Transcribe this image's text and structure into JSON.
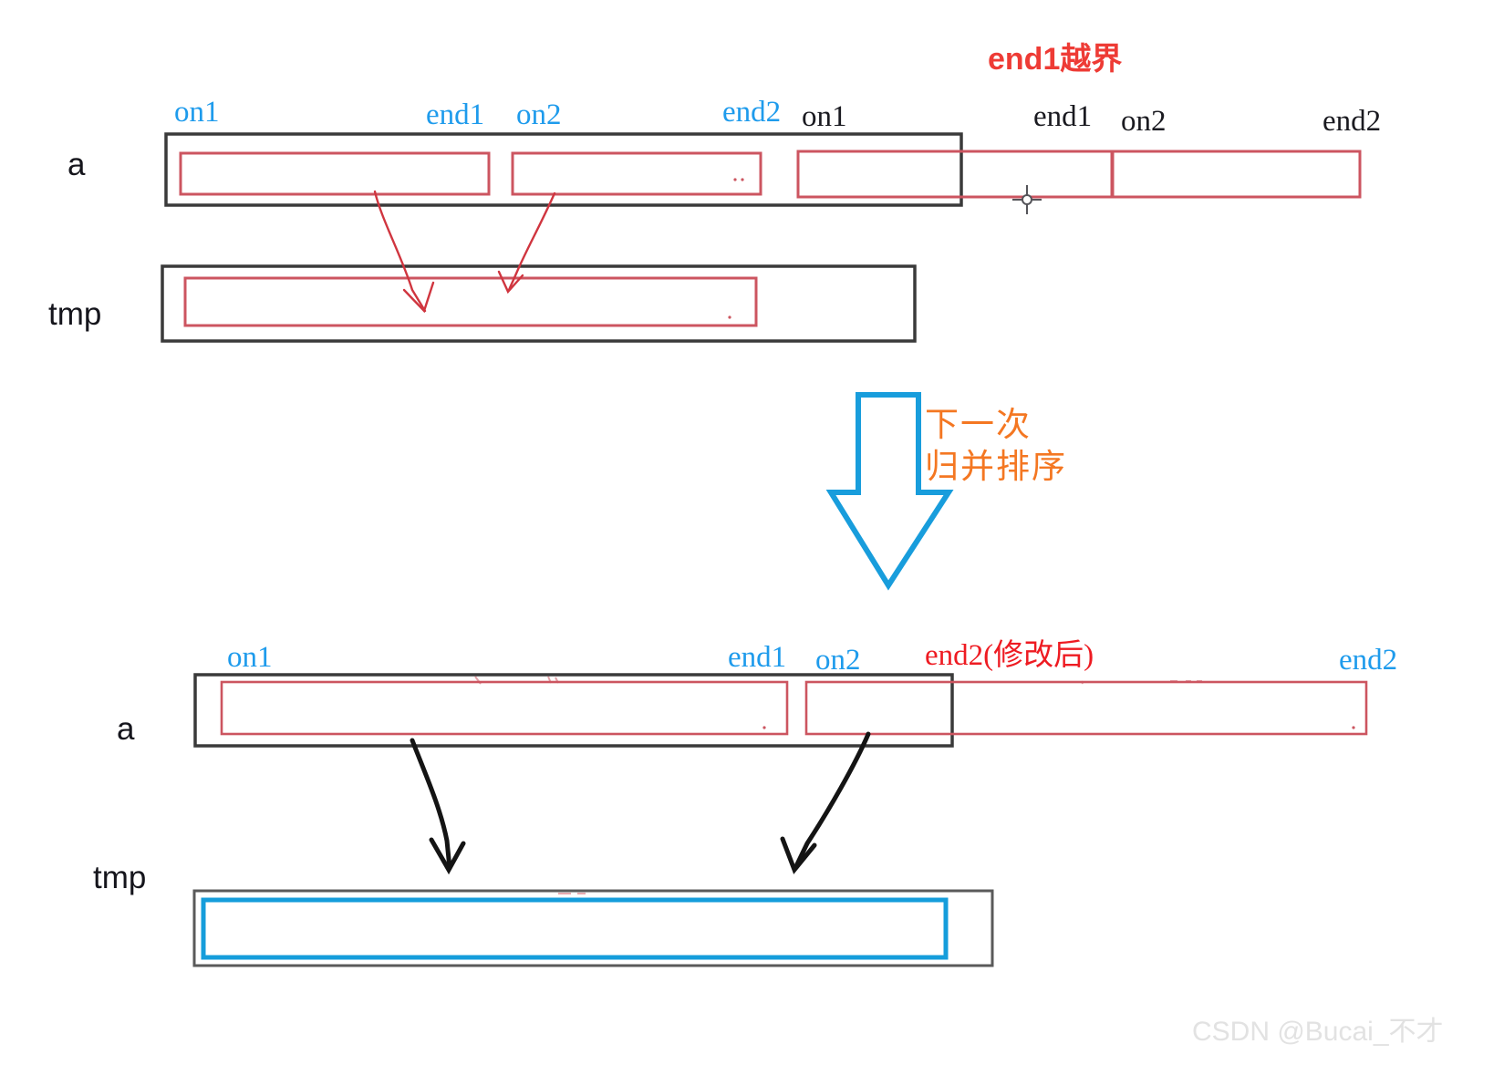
{
  "diagram": {
    "title_note": "end1越界",
    "watermark": "CSDN @Bucai_不才",
    "colors": {
      "blue_label": "#1e9bec",
      "red_label": "#ee1b22",
      "red_note": "#ee3b35",
      "orange_note": "#f47722",
      "black_box": "#3a3a3a",
      "red_box": "#cc5560",
      "blue_box": "#159ddb",
      "watermark": "#e2e2e2"
    },
    "top_section": {
      "row_a_label": "a",
      "row_tmp_label": "tmp",
      "labels": [
        {
          "text": "on1",
          "style": "blue"
        },
        {
          "text": "end1",
          "style": "blue"
        },
        {
          "text": "on2",
          "style": "blue"
        },
        {
          "text": "end2",
          "style": "blue"
        },
        {
          "text": "on1",
          "style": "black"
        },
        {
          "text": "end1",
          "style": "black"
        },
        {
          "text": "on2",
          "style": "black"
        },
        {
          "text": "end2",
          "style": "black"
        }
      ],
      "note": "end1越界"
    },
    "middle": {
      "arrow_note_line1": "下一次",
      "arrow_note_line2": "归并排序"
    },
    "bottom_section": {
      "row_a_label": "a",
      "row_tmp_label": "tmp",
      "labels": [
        {
          "text": "on1",
          "style": "blue"
        },
        {
          "text": "end1",
          "style": "blue"
        },
        {
          "text": "on2",
          "style": "blue"
        },
        {
          "text": "end2(修改后)",
          "style": "red"
        },
        {
          "text": "end2",
          "style": "blue"
        }
      ]
    }
  }
}
